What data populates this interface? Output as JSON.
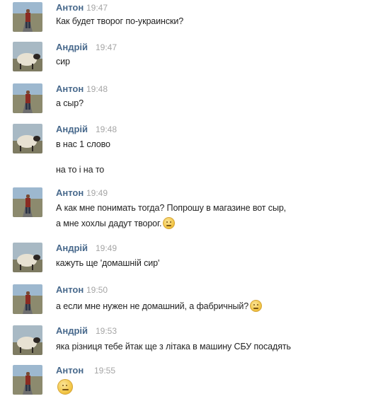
{
  "messages": [
    {
      "name": "Антон",
      "time": "19:47",
      "lines": [
        "Как будет творог по-украински?"
      ]
    },
    {
      "name": "Андрій",
      "time": "19:47",
      "lines": [
        "сир"
      ]
    },
    {
      "name": "Антон",
      "time": "19:48",
      "lines": [
        "а сыр?"
      ]
    },
    {
      "name": "Андрій",
      "time": "19:48",
      "lines": [
        "в нас 1 слово",
        "на то і на то"
      ]
    },
    {
      "name": "Антон",
      "time": "19:49",
      "lines": [
        "А как мне понимать тогда? Попрошу в магазине вот сыр,",
        "а мне хохлы дадут творог."
      ]
    },
    {
      "name": "Андрій",
      "time": "19:49",
      "lines": [
        "кажуть ще 'домашній сир'"
      ]
    },
    {
      "name": "Антон",
      "time": "19:50",
      "lines": [
        "а если мне нужен не домашний, а фабричный?"
      ]
    },
    {
      "name": "Андрій",
      "time": "19:53",
      "lines": [
        "яка різниця тебе йтак ще з літака в машину СБУ посадять"
      ]
    },
    {
      "name": "Антон",
      "time": "19:55",
      "lines": []
    }
  ],
  "icons": {
    "anton_avatar": "person-road-photo",
    "andriy_avatar": "sheep-photo",
    "emoji": "smiley-emoji"
  }
}
